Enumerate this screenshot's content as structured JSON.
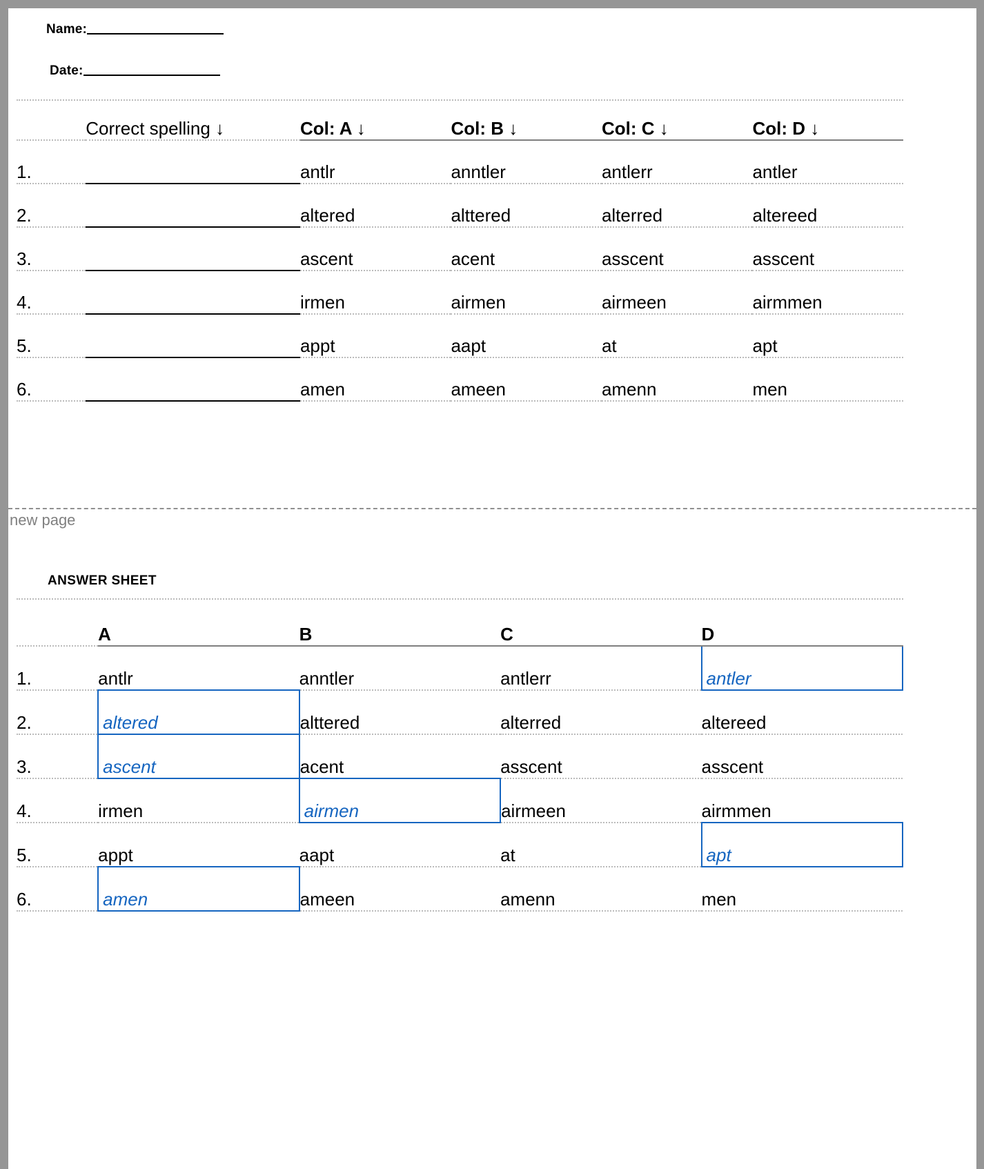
{
  "document": {
    "meta": {
      "name_label": "Name:",
      "date_label": "Date:"
    },
    "page_break_label": "new page",
    "answer_sheet_title": "ANSWER SHEET",
    "accent_color": "#1565c0",
    "rule_color": "#7f7f7f",
    "dotted_color": "#bbbbbb"
  },
  "worksheet": {
    "headers": {
      "number": "",
      "answer": "Correct spelling ↓",
      "col_a": "Col: A ↓",
      "col_b": "Col: B ↓",
      "col_c": "Col: C ↓",
      "col_d": "Col: D ↓"
    },
    "rows": [
      {
        "num": "1.",
        "answer": "",
        "a": "antlr",
        "b": "anntler",
        "c": "antlerr",
        "d": "antler"
      },
      {
        "num": "2.",
        "answer": "",
        "a": "altered",
        "b": "alttered",
        "c": "alterred",
        "d": "altereed"
      },
      {
        "num": "3.",
        "answer": "",
        "a": "ascent",
        "b": "acent",
        "c": "asscent",
        "d": "asscent"
      },
      {
        "num": "4.",
        "answer": "",
        "a": "irmen",
        "b": "airmen",
        "c": "airmeen",
        "d": "airmmen"
      },
      {
        "num": "5.",
        "answer": "",
        "a": "appt",
        "b": "aapt",
        "c": "at",
        "d": "apt"
      },
      {
        "num": "6.",
        "answer": "",
        "a": "amen",
        "b": "ameen",
        "c": "amenn",
        "d": "men"
      }
    ]
  },
  "answer_sheet": {
    "headers": {
      "number": "",
      "col_a": "A",
      "col_b": "B",
      "col_c": "C",
      "col_d": "D"
    },
    "rows": [
      {
        "num": "1.",
        "a": "antlr",
        "b": "anntler",
        "c": "antlerr",
        "d": "antler",
        "correct": "d"
      },
      {
        "num": "2.",
        "a": "altered",
        "b": "alttered",
        "c": "alterred",
        "d": "altereed",
        "correct": "a"
      },
      {
        "num": "3.",
        "a": "ascent",
        "b": "acent",
        "c": "asscent",
        "d": "asscent",
        "correct": "a"
      },
      {
        "num": "4.",
        "a": "irmen",
        "b": "airmen",
        "c": "airmeen",
        "d": "airmmen",
        "correct": "b"
      },
      {
        "num": "5.",
        "a": "appt",
        "b": "aapt",
        "c": "at",
        "d": "apt",
        "correct": "d"
      },
      {
        "num": "6.",
        "a": "amen",
        "b": "ameen",
        "c": "amenn",
        "d": "men",
        "correct": "a"
      }
    ]
  }
}
